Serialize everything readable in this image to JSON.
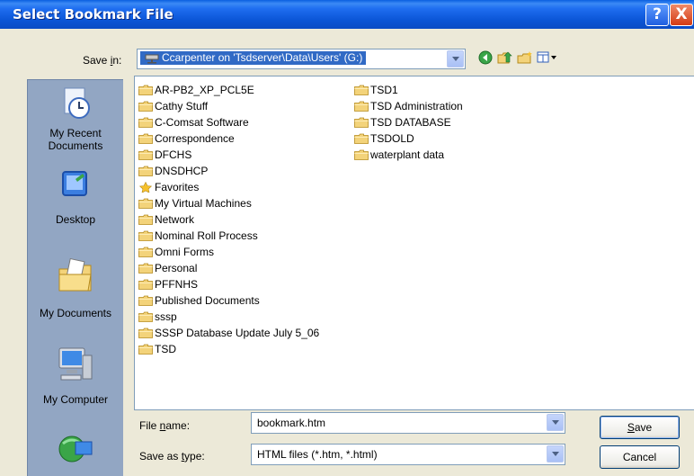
{
  "title": "Select Bookmark File",
  "title_buttons": {
    "help": "?",
    "close": "X"
  },
  "save_in": {
    "label_pre": "Save ",
    "label_key": "i",
    "label_post": "n:",
    "value": "Ccarpenter on 'Tsdserver\\Data\\Users' (G:)"
  },
  "toolbar": {
    "icons": [
      "back-icon",
      "up-folder-icon",
      "new-folder-icon",
      "views-menu-icon"
    ]
  },
  "places": [
    {
      "label": "My Recent Documents",
      "icon": "recent-documents-icon"
    },
    {
      "label": "Desktop",
      "icon": "desktop-icon"
    },
    {
      "label": "My Documents",
      "icon": "my-documents-icon"
    },
    {
      "label": "My Computer",
      "icon": "my-computer-icon"
    },
    {
      "label": "",
      "icon": "my-network-icon"
    }
  ],
  "files": {
    "col1": [
      {
        "name": "AR-PB2_XP_PCL5E",
        "type": "folder"
      },
      {
        "name": "Cathy Stuff",
        "type": "folder"
      },
      {
        "name": "C-Comsat Software",
        "type": "folder"
      },
      {
        "name": "Correspondence",
        "type": "folder"
      },
      {
        "name": "DFCHS",
        "type": "folder"
      },
      {
        "name": "DNSDHCP",
        "type": "folder"
      },
      {
        "name": "Favorites",
        "type": "favorites"
      },
      {
        "name": "My Virtual Machines",
        "type": "folder"
      },
      {
        "name": "Network",
        "type": "folder"
      },
      {
        "name": "Nominal Roll Process",
        "type": "folder"
      },
      {
        "name": "Omni Forms",
        "type": "folder"
      },
      {
        "name": "Personal",
        "type": "folder"
      },
      {
        "name": "PFFNHS",
        "type": "folder"
      },
      {
        "name": "Published Documents",
        "type": "folder"
      },
      {
        "name": "sssp",
        "type": "folder"
      },
      {
        "name": "SSSP Database Update July 5_06",
        "type": "folder"
      },
      {
        "name": "TSD",
        "type": "folder"
      }
    ],
    "col2": [
      {
        "name": "TSD1",
        "type": "folder"
      },
      {
        "name": "TSD Administration",
        "type": "folder"
      },
      {
        "name": "TSD DATABASE",
        "type": "folder"
      },
      {
        "name": "TSDOLD",
        "type": "folder"
      },
      {
        "name": "waterplant data",
        "type": "folder"
      }
    ]
  },
  "file_name": {
    "label_pre": "File ",
    "label_key": "n",
    "label_post": "ame:",
    "value": "bookmark.htm"
  },
  "save_as_type": {
    "label_pre": "Save as ",
    "label_key": "t",
    "label_post": "ype:",
    "value": "HTML files (*.htm, *.html)"
  },
  "buttons": {
    "save_key": "S",
    "save_rest": "ave",
    "cancel": "Cancel"
  },
  "colors": {
    "title_bar": "#0b55d6",
    "selection": "#316ac5",
    "places_bar": "#92a6c3",
    "folder": "#f3d37a"
  }
}
